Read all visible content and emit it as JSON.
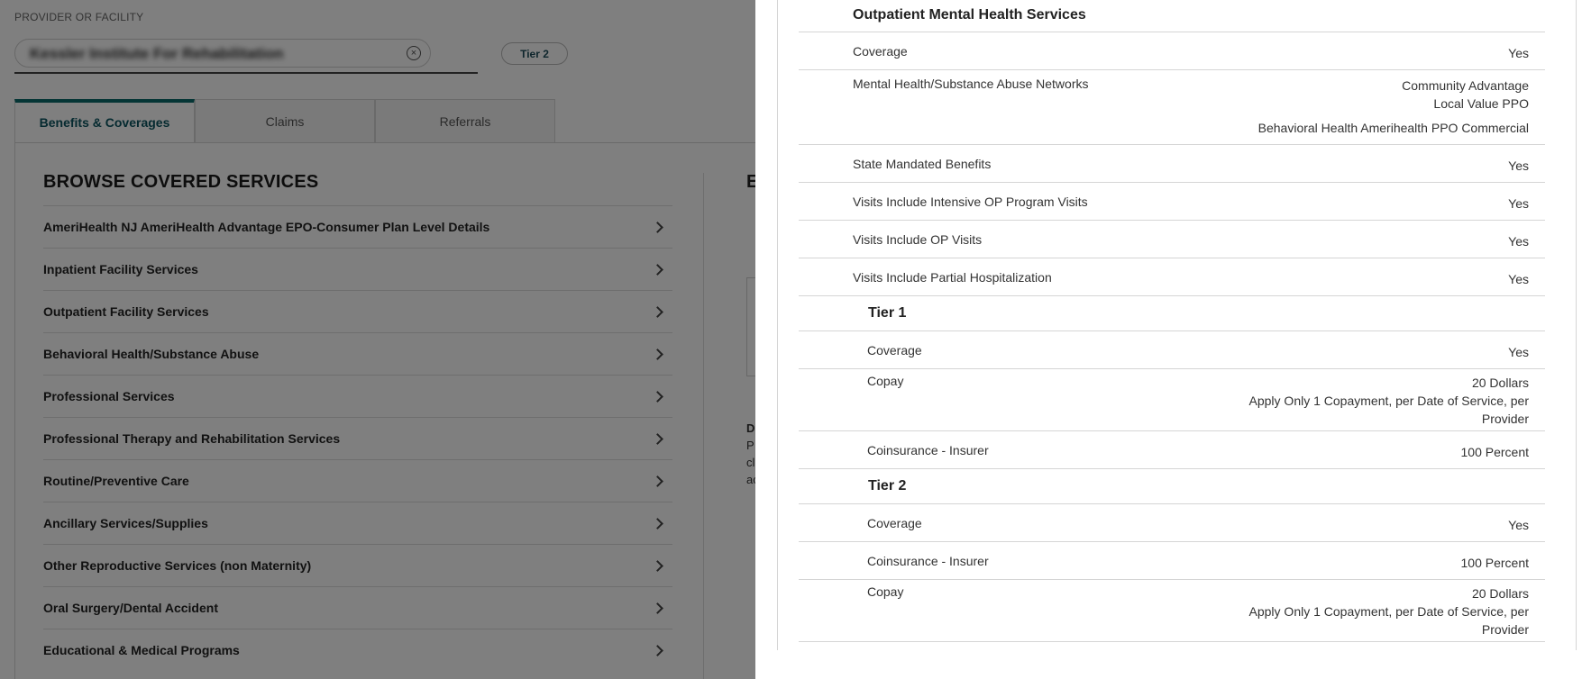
{
  "provider": {
    "label": "PROVIDER OR FACILITY",
    "value": "Kessler Institute For Rehabilitation",
    "tier_chip": "Tier 2"
  },
  "tabs": [
    {
      "label": "Benefits & Coverages",
      "active": true
    },
    {
      "label": "Claims",
      "active": false
    },
    {
      "label": "Referrals",
      "active": false
    }
  ],
  "browse": {
    "title": "BROWSE COVERED SERVICES",
    "items": [
      "AmeriHealth NJ AmeriHealth Advantage EPO-Consumer Plan Level Details",
      "Inpatient Facility Services",
      "Outpatient Facility Services",
      "Behavioral Health/Substance Abuse",
      "Professional Services",
      "Professional Therapy and Rehabilitation Services",
      "Routine/Preventive Care",
      "Ancillary Services/Supplies",
      "Other Reproductive Services (non Maternity)",
      "Oral Surgery/Dental Accident",
      "Educational & Medical Programs"
    ]
  },
  "peek": {
    "letter": "E",
    "lines": [
      "D",
      "P",
      "cl",
      "ac"
    ]
  },
  "drawer": {
    "title": "Outpatient Mental Health Services",
    "rows": [
      {
        "label": "Coverage",
        "values": [
          "Yes"
        ]
      },
      {
        "label": "Mental Health/Substance Abuse Networks",
        "values": [
          "Community Advantage",
          "Local Value PPO",
          "Behavioral Health Amerihealth PPO Commercial"
        ]
      },
      {
        "label": "State Mandated Benefits",
        "values": [
          "Yes"
        ]
      },
      {
        "label": "Visits Include Intensive OP Program Visits",
        "values": [
          "Yes"
        ]
      },
      {
        "label": "Visits Include OP Visits",
        "values": [
          "Yes"
        ]
      },
      {
        "label": "Visits Include Partial Hospitalization",
        "values": [
          "Yes"
        ]
      }
    ],
    "tiers": [
      {
        "name": "Tier 1",
        "rows": [
          {
            "label": "Coverage",
            "values": [
              "Yes"
            ]
          },
          {
            "label": "Copay",
            "values": [
              "20 Dollars",
              "Apply Only 1 Copayment, per Date of Service, per",
              "Provider"
            ]
          },
          {
            "label": "Coinsurance - Insurer",
            "values": [
              "100 Percent"
            ]
          }
        ]
      },
      {
        "name": "Tier 2",
        "rows": [
          {
            "label": "Coverage",
            "values": [
              "Yes"
            ]
          },
          {
            "label": "Coinsurance - Insurer",
            "values": [
              "100 Percent"
            ]
          },
          {
            "label": "Copay",
            "values": [
              "20 Dollars",
              "Apply Only 1 Copayment, per Date of Service, per",
              "Provider"
            ]
          }
        ]
      }
    ]
  }
}
